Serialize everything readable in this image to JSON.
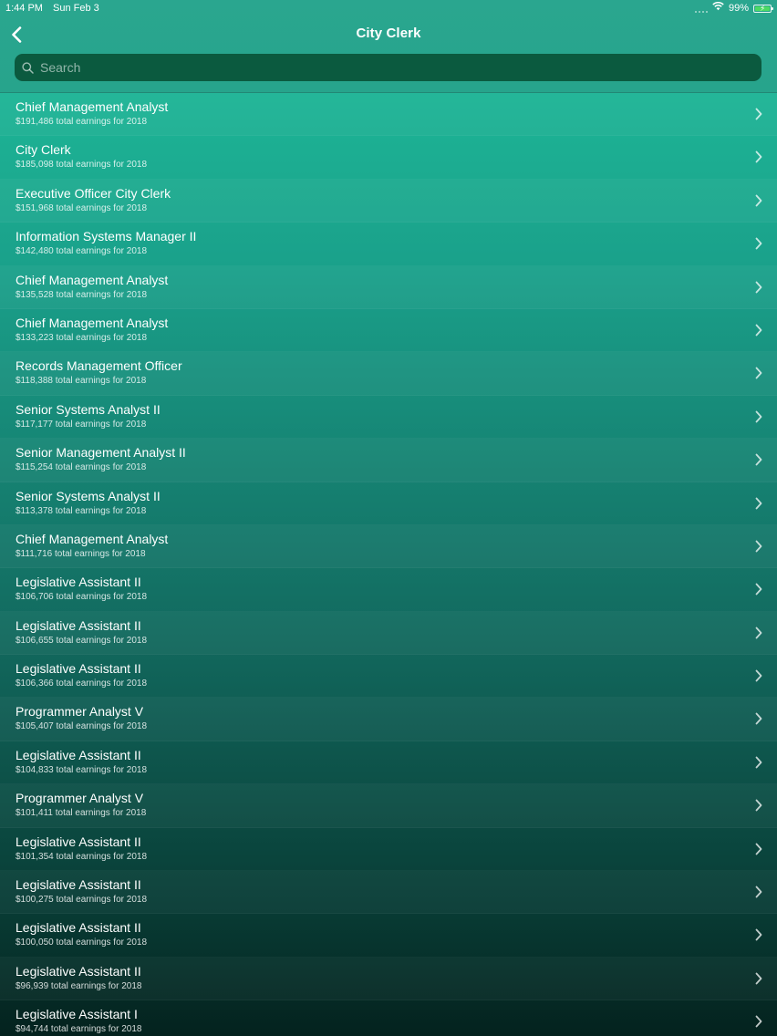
{
  "status_bar": {
    "time": "1:44 PM",
    "date": "Sun Feb 3",
    "battery_percent": "99%",
    "battery_level": 0.99,
    "icons": [
      "signal-icon",
      "wifi-icon",
      "battery-icon"
    ]
  },
  "nav": {
    "title": "City Clerk",
    "back_icon": "chevron-left-icon"
  },
  "search": {
    "placeholder": "Search",
    "value": "",
    "icon": "search-icon"
  },
  "colors": {
    "header": "#27a48c",
    "search_field": "#0b5a3f",
    "list_top": "#1fbf9c",
    "list_bottom": "#04221e",
    "battery": "#4cd964"
  },
  "rows": [
    {
      "title": "Chief Management Analyst",
      "subtitle": "$191,486 total earnings for 2018"
    },
    {
      "title": "City Clerk",
      "subtitle": "$185,098 total earnings for 2018"
    },
    {
      "title": "Executive Officer City Clerk",
      "subtitle": "$151,968 total earnings for 2018"
    },
    {
      "title": "Information Systems Manager II",
      "subtitle": "$142,480 total earnings for 2018"
    },
    {
      "title": "Chief Management Analyst",
      "subtitle": "$135,528 total earnings for 2018"
    },
    {
      "title": "Chief Management Analyst",
      "subtitle": "$133,223 total earnings for 2018"
    },
    {
      "title": "Records Management Officer",
      "subtitle": "$118,388 total earnings for 2018"
    },
    {
      "title": "Senior Systems Analyst II",
      "subtitle": "$117,177 total earnings for 2018"
    },
    {
      "title": "Senior Management Analyst II",
      "subtitle": "$115,254 total earnings for 2018"
    },
    {
      "title": "Senior Systems Analyst II",
      "subtitle": "$113,378 total earnings for 2018"
    },
    {
      "title": "Chief Management Analyst",
      "subtitle": "$111,716 total earnings for 2018"
    },
    {
      "title": "Legislative Assistant II",
      "subtitle": "$106,706 total earnings for 2018"
    },
    {
      "title": "Legislative Assistant II",
      "subtitle": "$106,655 total earnings for 2018"
    },
    {
      "title": "Legislative Assistant II",
      "subtitle": "$106,366 total earnings for 2018"
    },
    {
      "title": "Programmer Analyst V",
      "subtitle": "$105,407 total earnings for 2018"
    },
    {
      "title": "Legislative Assistant II",
      "subtitle": "$104,833 total earnings for 2018"
    },
    {
      "title": "Programmer Analyst V",
      "subtitle": "$101,411 total earnings for 2018"
    },
    {
      "title": "Legislative Assistant II",
      "subtitle": "$101,354 total earnings for 2018"
    },
    {
      "title": "Legislative Assistant II",
      "subtitle": "$100,275 total earnings for 2018"
    },
    {
      "title": "Legislative Assistant II",
      "subtitle": "$100,050 total earnings for 2018"
    },
    {
      "title": "Legislative Assistant II",
      "subtitle": "$96,939 total earnings for 2018"
    },
    {
      "title": "Legislative Assistant I",
      "subtitle": "$94,744 total earnings for 2018"
    }
  ]
}
